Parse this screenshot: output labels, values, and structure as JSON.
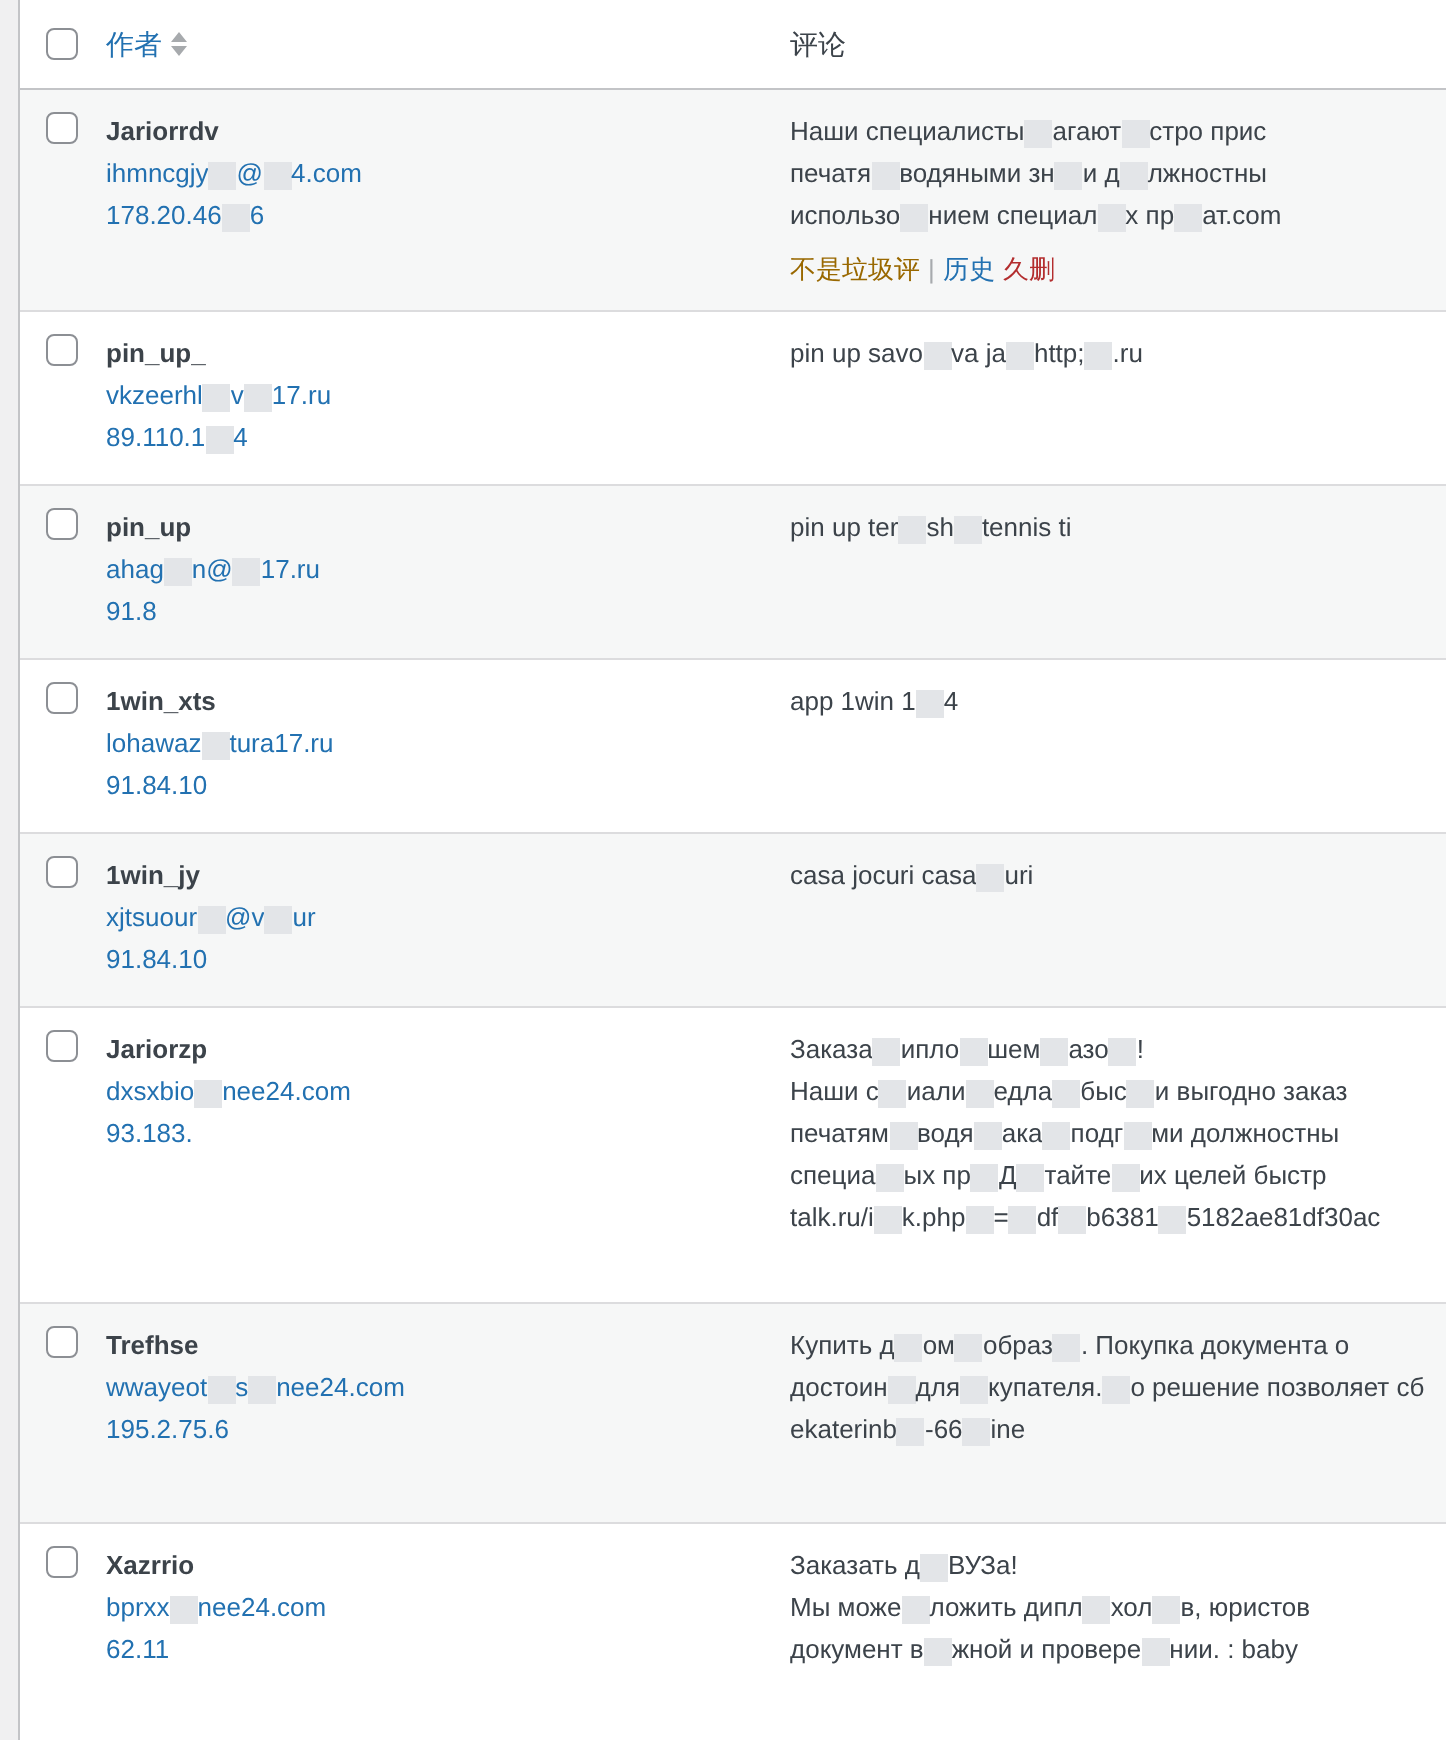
{
  "table": {
    "select_all": {
      "checked": false
    },
    "columns": [
      {
        "label": "作者",
        "sortable": true
      },
      {
        "label": "评论",
        "sortable": false
      }
    ],
    "rows": [
      {
        "checked": false,
        "author": [
          "Jariorrdv"
        ],
        "email": [
          "ihmncgjy",
          "@",
          "4.com"
        ],
        "ip": [
          "178.20.46",
          "6"
        ],
        "comment": [
          [
            "Наши специалисты",
            "агают",
            "стро прис"
          ],
          [
            "печатя",
            "водяными зн",
            "и д",
            "лжностны"
          ],
          [
            "использо",
            "нием специал",
            "х пр",
            "ат.com"
          ]
        ],
        "actions": [
          {
            "kind": "unspam",
            "segments": [
              "不是垃圾评"
            ]
          },
          {
            "kind": "separator",
            "segments": [
              "|"
            ]
          },
          {
            "kind": "history",
            "segments": [
              "历史"
            ]
          },
          {
            "kind": "delete",
            "segments": [
              "久删"
            ]
          }
        ]
      },
      {
        "checked": false,
        "author": [
          "pin_up_"
        ],
        "email": [
          "vkzeerhl",
          "v",
          "17.ru"
        ],
        "ip": [
          "89.110.1",
          "4"
        ],
        "comment": [
          [
            "pin up savo",
            "va ja",
            "http;",
            ".ru"
          ]
        ]
      },
      {
        "checked": false,
        "author": [
          "pin_up"
        ],
        "email": [
          "ahag",
          "n@",
          "17.ru"
        ],
        "ip": [
          "91.8"
        ],
        "comment": [
          [
            "pin up ter",
            "sh",
            "tennis ti"
          ]
        ]
      },
      {
        "checked": false,
        "author": [
          "1win_xts"
        ],
        "email": [
          "lohawaz",
          "tura17.ru"
        ],
        "ip": [
          "91.84.10"
        ],
        "comment": [
          [
            "app 1win 1",
            "4"
          ]
        ]
      },
      {
        "checked": false,
        "author": [
          "1win_jy"
        ],
        "email": [
          "xjtsuour",
          "@v",
          "ur"
        ],
        "ip": [
          "91.84.10"
        ],
        "comment": [
          [
            "casa jocuri casa",
            "uri"
          ]
        ]
      },
      {
        "checked": false,
        "author": [
          "Jariorzp"
        ],
        "email": [
          "dxsxbio",
          "nee24.com"
        ],
        "ip": [
          "93.183."
        ],
        "comment": [
          [
            "Заказа",
            "ипло",
            "шем",
            "азо",
            "!"
          ],
          [
            "Наши с",
            "иали",
            "едла",
            "быс",
            "и выгодно заказ"
          ],
          [
            "печатям",
            "водя",
            "ака",
            "подг",
            "ми должностны"
          ],
          [
            "специа",
            "ых пр",
            "Д",
            "тайте",
            "их целей быстр"
          ],
          [
            "talk.ru/i",
            "k.php",
            "=",
            "df",
            "b6381",
            "5182ae81df30ac"
          ]
        ]
      },
      {
        "checked": false,
        "author": [
          "Trefhse"
        ],
        "email": [
          "wwayeot",
          "s",
          "nee24.com"
        ],
        "ip": [
          "195.2.75.6"
        ],
        "comment": [
          [
            "Купить д",
            "ом",
            "образ",
            ". Покупка документа о"
          ],
          [
            "достоин",
            "для",
            "купателя.",
            "о решение позволяет сб"
          ],
          [
            "ekaterinb",
            "-66",
            "ine"
          ]
        ]
      },
      {
        "checked": false,
        "author": [
          "Xazrrio"
        ],
        "email": [
          "bprxx",
          "nee24.com"
        ],
        "ip": [
          "62.11"
        ],
        "comment": [
          [
            "Заказать д",
            "ВУЗа!"
          ],
          [
            "Мы може",
            "ложить дипл",
            "хол",
            "в, юристов"
          ],
          [
            "документ в",
            "жной и провере",
            "нии. : baby"
          ]
        ]
      }
    ]
  }
}
